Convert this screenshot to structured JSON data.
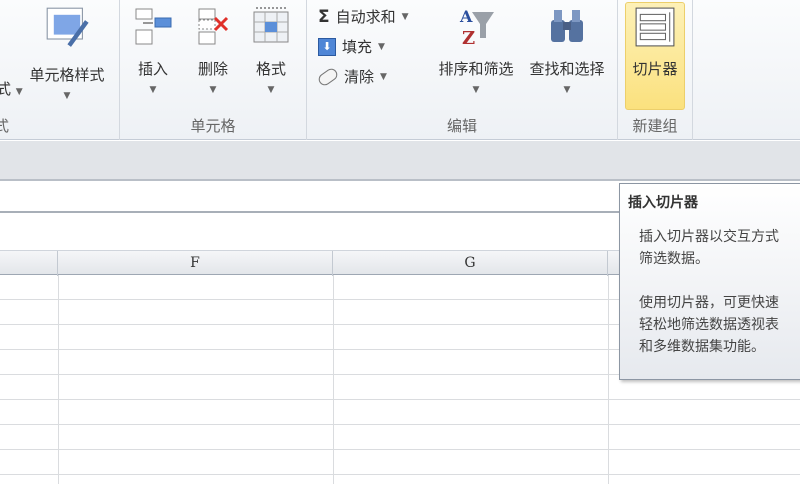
{
  "ribbon": {
    "partial_left": {
      "label": "式",
      "group": "式"
    },
    "cell_styles": "单元格样式",
    "cells_group": {
      "label": "单元格",
      "insert": "插入",
      "delete": "删除",
      "format": "格式"
    },
    "editing_group": {
      "label": "编辑",
      "autosum": "自动求和",
      "fill": "填充",
      "clear": "清除",
      "sort_filter": "排序和筛选",
      "find_select": "查找和选择"
    },
    "new_group": {
      "label": "新建组",
      "slicer": "切片器"
    }
  },
  "columns": [
    "F",
    "G"
  ],
  "tooltip": {
    "title": "插入切片器",
    "p1": "插入切片器以交互方式\n筛选数据。",
    "p2": "使用切片器，可更快速\n轻松地筛选数据透视表\n和多维数据集功能。"
  }
}
